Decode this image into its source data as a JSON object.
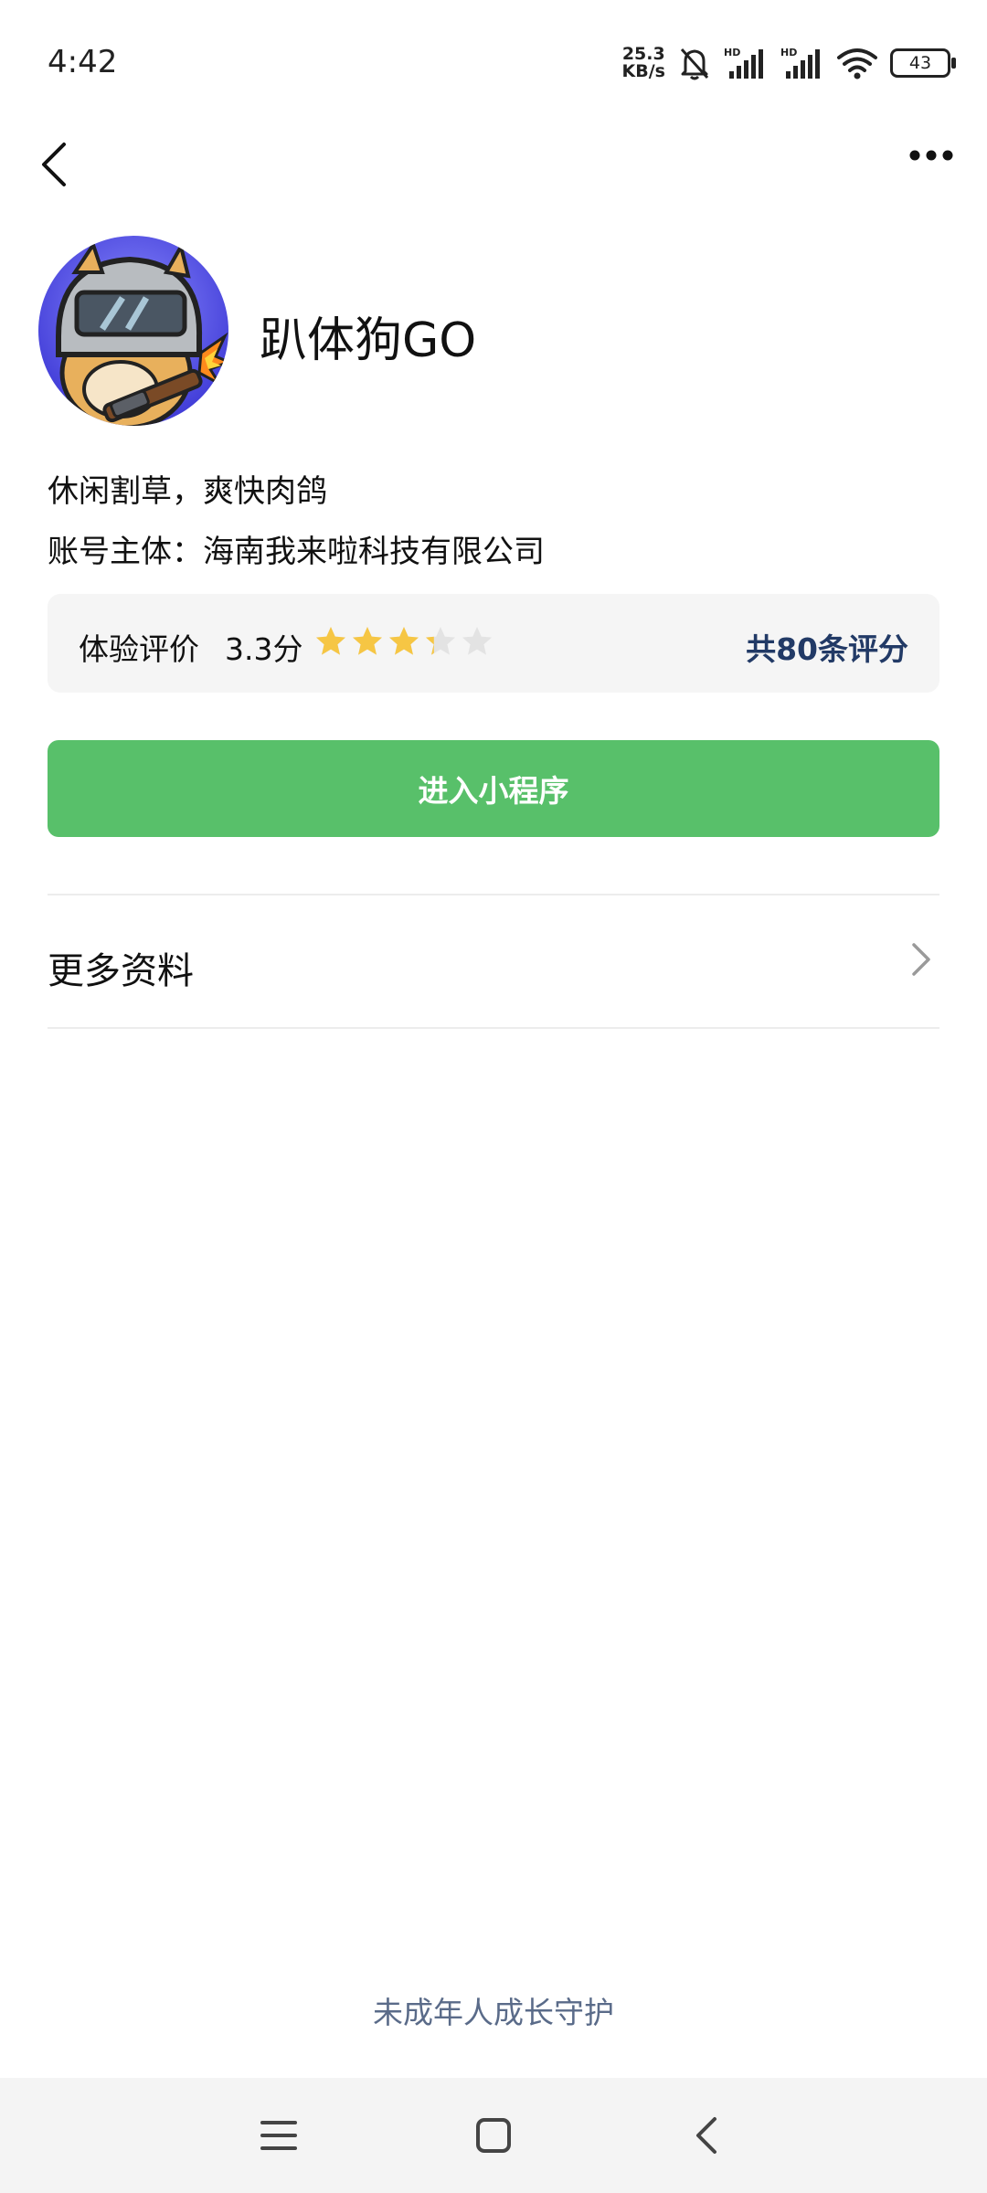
{
  "status_bar": {
    "time": "4:42",
    "net_speed_value": "25.3",
    "net_speed_unit": "KB/s",
    "battery": "43",
    "icons": [
      "bell-muted-icon",
      "signal-hd-icon",
      "signal-hd-icon",
      "wifi-icon",
      "battery-icon"
    ]
  },
  "nav": {
    "back_icon": "back-arrow-icon",
    "more_icon": "more-dots-icon"
  },
  "app": {
    "name": "趴体狗GO",
    "description": "休闲割草，爽快肉鸽",
    "entity": "账号主体：海南我来啦科技有限公司"
  },
  "rating": {
    "label": "体验评价",
    "score": "3.3分",
    "stars": 3.3,
    "max_stars": 5,
    "count": "共80条评分",
    "star_color": "#f6c644",
    "empty_star_color": "#e3e3e3"
  },
  "primary_button": {
    "label": "进入小程序",
    "color": "#58c06a"
  },
  "more_info": {
    "label": "更多资料"
  },
  "footer": {
    "guardian": "未成年人成长守护"
  },
  "system_nav": {
    "menu_icon": "menu-icon",
    "home_icon": "home-square-icon",
    "back_icon": "back-triangle-icon"
  }
}
